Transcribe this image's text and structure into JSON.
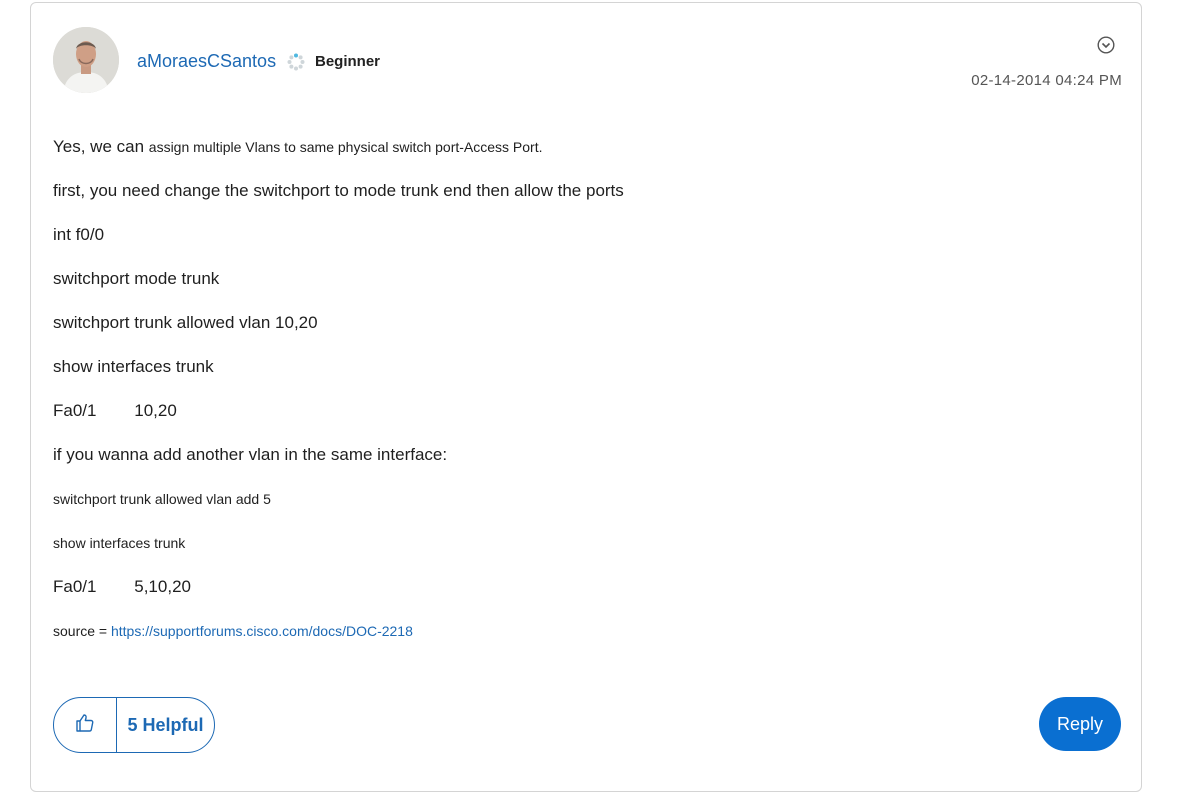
{
  "post": {
    "author": "aMoraesCSantos",
    "rank": "Beginner",
    "timestamp": "02-14-2014 04:24 PM",
    "icons": {
      "avatar": "user-photo",
      "rank": "rank-badge-icon",
      "menu": "chevron-down-circle-icon",
      "like": "thumbs-up-icon"
    },
    "lines": {
      "l1a": "Yes, we can ",
      "l1b": "assign multiple Vlans to same physical switch port-Access Port.",
      "l2": "first, you need change the switchport to mode trunk end then allow the ports",
      "l3": "int f0/0",
      "l4": "switchport mode trunk",
      "l5": "switchport trunk allowed vlan 10,20",
      "l6": "show interfaces trunk",
      "l7": "Fa0/1        10,20",
      "l8": "if you wanna add another vlan in the same interface:",
      "l9": "switchport trunk allowed vlan add 5",
      "l10": "show interfaces trunk",
      "l11": "Fa0/1        5,10,20",
      "source_label": "source = ",
      "source_link": "https://supportforums.cisco.com/docs/DOC-2218"
    },
    "helpful_label": "5 Helpful",
    "reply_label": "Reply"
  },
  "colors": {
    "link": "#1d69b4",
    "reply_bg": "#0a6fd1",
    "border": "#d4d4d4"
  }
}
